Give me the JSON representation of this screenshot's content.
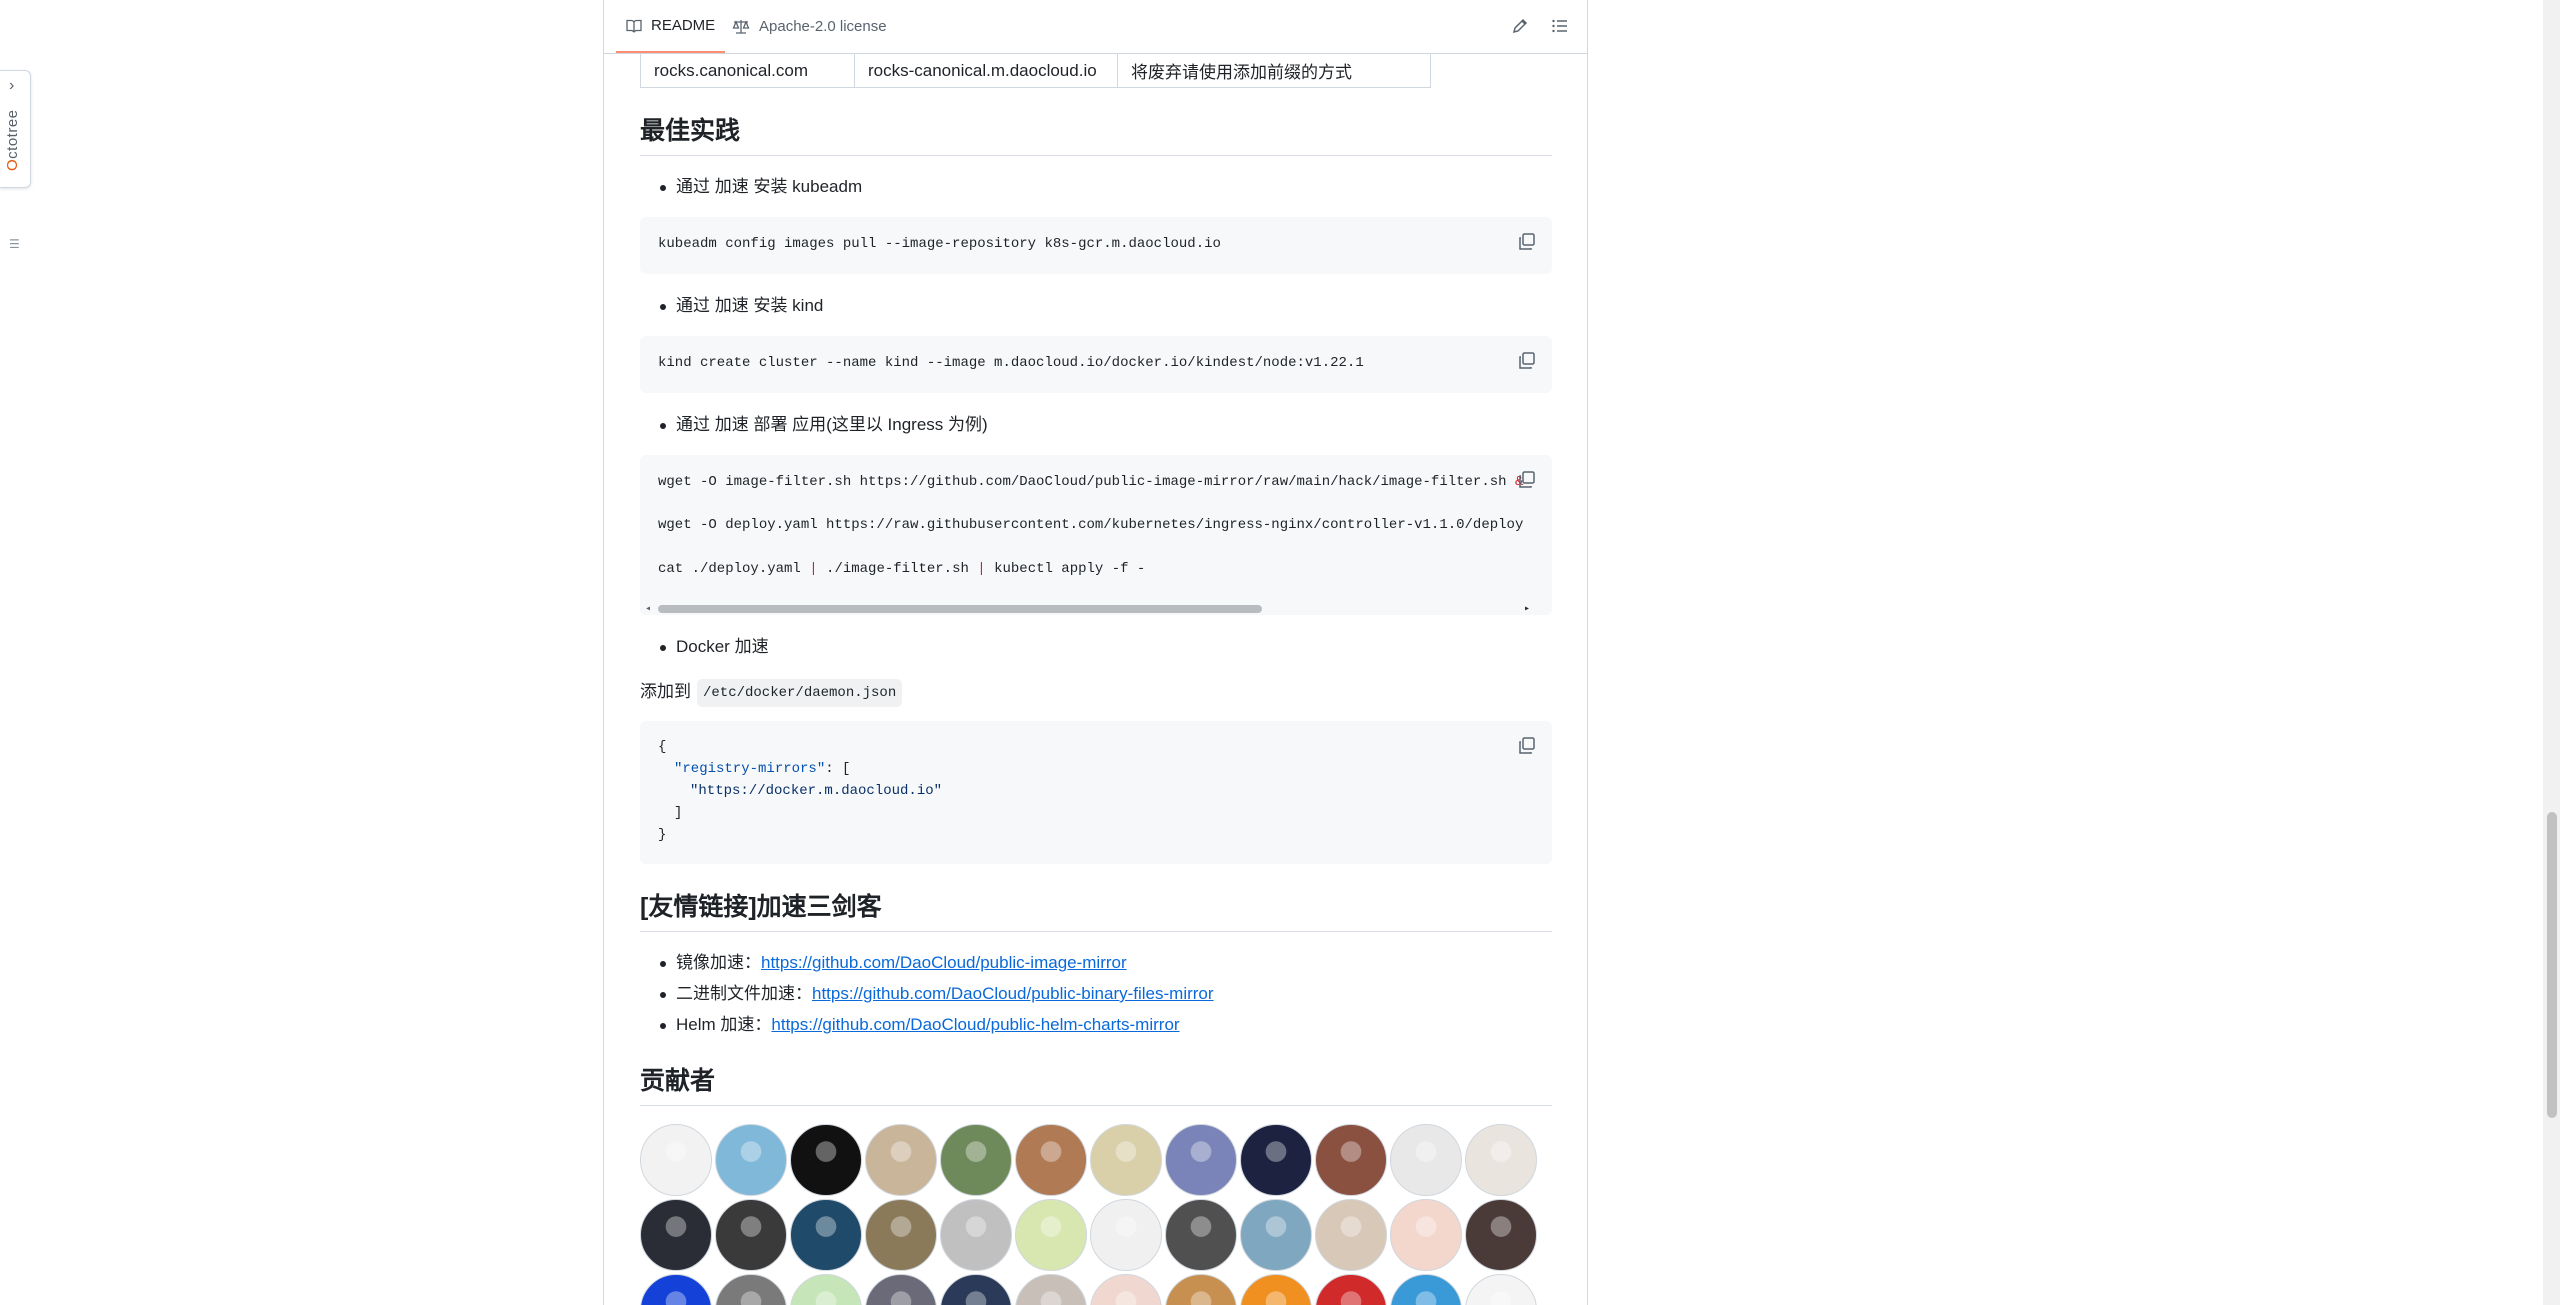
{
  "octotree": {
    "label": "Octotree"
  },
  "header": {
    "readme_tab": "README",
    "license_tab": "Apache-2.0 license"
  },
  "mirror_table": {
    "row": [
      "rocks.canonical.com",
      "rocks-canonical.m.daocloud.io",
      "将废弃请使用添加前缀的方式"
    ]
  },
  "best_practice": {
    "title": "最佳实践",
    "kubeadm_label": "通过 加速 安装 kubeadm",
    "kubeadm_cmd": "kubeadm config images pull --image-repository k8s-gcr.m.daocloud.io",
    "kind_label": "通过 加速 安装 kind",
    "kind_cmd": "kind create cluster --name kind --image m.daocloud.io/docker.io/kindest/node:v1.22.1",
    "deploy_label": "通过 加速 部署 应用(这里以 Ingress 为例)",
    "deploy_line1": "wget -O image-filter.sh https://github.com/DaoCloud/public-image-mirror/raw/main/hack/image-filter.sh ",
    "deploy_line1_tail": "&",
    "deploy_line2": "wget -O deploy.yaml https://raw.githubusercontent.com/kubernetes/ingress-nginx/controller-v1.1.0/deploy",
    "deploy_line3_a": "cat ./deploy.yaml ",
    "deploy_line3_pipe1": "|",
    "deploy_line3_b": " ./image-filter.sh ",
    "deploy_line3_pipe2": "|",
    "deploy_line3_c": " kubectl apply -f -",
    "docker_label": "Docker 加速",
    "add_to": "添加到",
    "daemon_path": "/etc/docker/daemon.json",
    "json_open": "{",
    "json_key": "\"registry-mirrors\"",
    "json_key_tail": ": [",
    "json_value": "\"https://docker.m.daocloud.io\"",
    "json_bracket_close": "]",
    "json_close": "}"
  },
  "friend_links": {
    "title": "[友情链接]加速三剑客",
    "items": [
      {
        "label": "镜像加速：",
        "url": "https://github.com/DaoCloud/public-image-mirror"
      },
      {
        "label": "二进制文件加速：",
        "url": "https://github.com/DaoCloud/public-binary-files-mirror"
      },
      {
        "label": "Helm 加速：",
        "url": "https://github.com/DaoCloud/public-helm-charts-mirror"
      }
    ]
  },
  "contributors": {
    "title": "贡献者",
    "avatar_colors": [
      "#f2f2f2",
      "#7fb8d8",
      "#111111",
      "#c9b59a",
      "#6f8a5a",
      "#b07a55",
      "#d9cfa9",
      "#7a84b8",
      "#1c2240",
      "#8a5040",
      "#e8e8e8",
      "#e9e4de",
      "#2a2d35",
      "#3a3a3a",
      "#1f4a6a",
      "#8a7a5a",
      "#c0c0c0",
      "#d8e6b0",
      "#f0f0f0",
      "#505050",
      "#7fa7c0",
      "#d8c8b8",
      "#f3d6cc",
      "#4a3a38",
      "#1442d8",
      "#7a7a7a",
      "#c6e5b8",
      "#6a6a78",
      "#2a3a58",
      "#c8c0b8",
      "#f0d8d0",
      "#c89050",
      "#f09020",
      "#d02a2a",
      "#3a9ad8",
      "#f4f4f4"
    ]
  },
  "colors": {
    "link": "#0969da",
    "tab_underline": "#fd8c73",
    "code_bg": "#f6f8fa"
  },
  "icons": [
    "chevron-right-icon",
    "book-icon",
    "law-icon",
    "pencil-icon",
    "list-icon",
    "copy-icon"
  ]
}
